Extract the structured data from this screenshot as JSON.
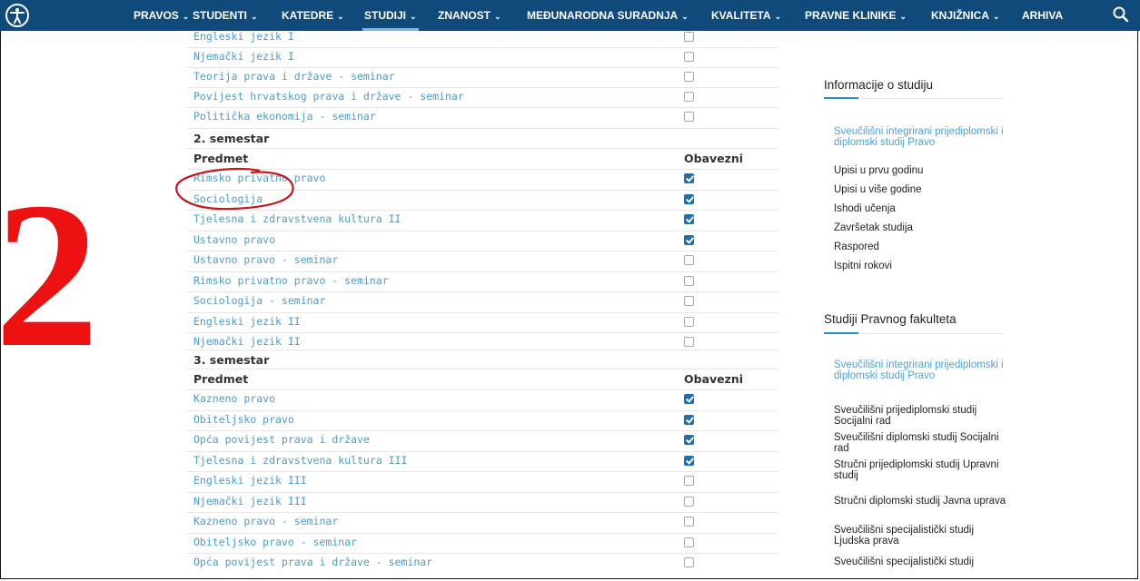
{
  "nav": {
    "items": [
      {
        "label": "PRAVOS",
        "chev": "⌄"
      },
      {
        "label": "STUDENTI",
        "chev": "⌄"
      },
      {
        "label": "KATEDRE",
        "chev": "⌄"
      },
      {
        "label": "STUDIJI",
        "chev": "⌄",
        "active": true
      },
      {
        "label": "ZNANOST",
        "chev": "⌄"
      },
      {
        "label": "MEĐUNARODNA SURADNJA",
        "chev": "⌄"
      },
      {
        "label": "KVALITETA",
        "chev": "⌄"
      },
      {
        "label": "PRAVNE KLINIKE",
        "chev": "⌄"
      },
      {
        "label": "KNJIŽNICA",
        "chev": "⌄"
      },
      {
        "label": "ARHIVA",
        "chev": ""
      }
    ],
    "bg_color": "#0f4a7a"
  },
  "table": {
    "sem1_tail": [
      {
        "subject": "Engleski jezik I",
        "required": false
      },
      {
        "subject": "Njemački jezik I",
        "required": false
      },
      {
        "subject": "Teorija prava i države - seminar",
        "required": false
      },
      {
        "subject": "Povijest hrvatskog prava i države - seminar",
        "required": false
      },
      {
        "subject": "Politička ekonomija - seminar",
        "required": false
      }
    ],
    "sem2_title": "2. semestar",
    "col_subject": "Predmet",
    "col_required": "Obavezni",
    "sem2": [
      {
        "subject": "Rimsko privatno pravo",
        "required": true
      },
      {
        "subject": "Sociologija",
        "required": true
      },
      {
        "subject": "Tjelesna i zdravstvena kultura II",
        "required": true
      },
      {
        "subject": "Ustavno pravo",
        "required": true
      },
      {
        "subject": "Ustavno pravo - seminar",
        "required": false
      },
      {
        "subject": "Rimsko privatno pravo - seminar",
        "required": false
      },
      {
        "subject": "Sociologija - seminar",
        "required": false
      },
      {
        "subject": "Engleski jezik II",
        "required": false
      },
      {
        "subject": "Njemački jezik II",
        "required": false
      }
    ],
    "sem3_title": "3. semestar",
    "sem3": [
      {
        "subject": "Kazneno pravo",
        "required": true
      },
      {
        "subject": "Obiteljsko pravo",
        "required": true
      },
      {
        "subject": "Opća povijest prava i države",
        "required": true
      },
      {
        "subject": "Tjelesna i zdravstvena kultura III",
        "required": true
      },
      {
        "subject": "Engleski jezik III",
        "required": false
      },
      {
        "subject": "Njemački jezik III",
        "required": false
      },
      {
        "subject": "Kazneno pravo - seminar",
        "required": false
      },
      {
        "subject": "Obiteljsko pravo - seminar",
        "required": false
      },
      {
        "subject": "Opća povijest prava i države - seminar",
        "required": false
      }
    ],
    "link_color": "#4d9cc9",
    "checked_color": "#1e6fb0"
  },
  "sidebar": {
    "info_title": "Informacije o studiju",
    "info_links": [
      {
        "label": "Sveučilišni integrirani prijediplomski i diplomski studij Pravo",
        "active": true
      },
      {
        "label": "Upisi u prvu godinu"
      },
      {
        "label": "Upisi u više godine"
      },
      {
        "label": "Ishodi učenja"
      },
      {
        "label": "Završetak studija"
      },
      {
        "label": "Raspored"
      },
      {
        "label": "Ispitni rokovi"
      }
    ],
    "studies_title": "Studiji Pravnog fakulteta",
    "studies_links": [
      {
        "label": "Sveučilišni integrirani prijediplomski i diplomski studij Pravo",
        "active": true
      },
      {
        "label": "Sveučilišni prijediplomski studij Socijalni rad"
      },
      {
        "label": "Sveučilišni diplomski studij Socijalni rad"
      },
      {
        "label": "Stručni prijediplomski studij Upravni studij"
      },
      {
        "label": "Stručni diplomski studij Javna uprava"
      },
      {
        "label": "Sveučilišni specijalistički studij Ljudska prava"
      },
      {
        "label": "Sveučilišni specijalistički studij"
      }
    ]
  },
  "overlay": {
    "step_number": "2",
    "color": "#ee1111"
  }
}
